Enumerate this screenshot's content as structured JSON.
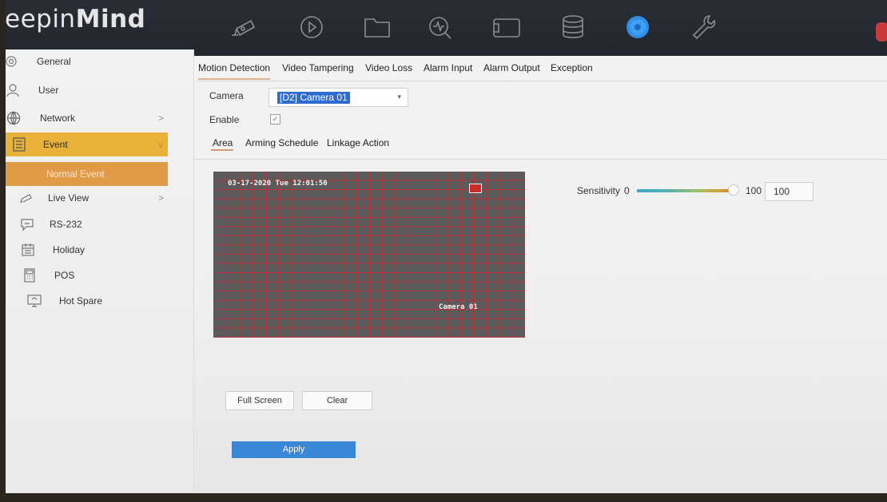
{
  "app": {
    "logo_light": "eepin",
    "logo_bold": "Mind"
  },
  "top_icons": [
    "camera-icon",
    "playback-icon",
    "folder-icon",
    "search-icon",
    "video-icon",
    "storage-icon",
    "settings-icon",
    "wrench-icon"
  ],
  "sidebar": {
    "items": [
      {
        "label": "General",
        "icon": "gear-icon"
      },
      {
        "label": "User",
        "icon": "user-icon"
      },
      {
        "label": "Network",
        "icon": "globe-icon",
        "chevron": ">"
      },
      {
        "label": "Event",
        "icon": "event-icon",
        "chevron": "v"
      },
      {
        "label": "Normal Event"
      },
      {
        "label": "Live View",
        "icon": "camera-icon",
        "chevron": ">"
      },
      {
        "label": "RS-232",
        "icon": "chat-icon"
      },
      {
        "label": "Holiday",
        "icon": "calendar-icon"
      },
      {
        "label": "POS",
        "icon": "pos-icon"
      },
      {
        "label": "Hot Spare",
        "icon": "monitor-icon"
      }
    ]
  },
  "main_tabs": [
    "Motion Detection",
    "Video Tampering",
    "Video Loss",
    "Alarm Input",
    "Alarm Output",
    "Exception"
  ],
  "form": {
    "camera_label": "Camera",
    "camera_value": "[D2] Camera 01",
    "enable_label": "Enable",
    "enable_check": "✓"
  },
  "sub_tabs": [
    "Area",
    "Arming Schedule",
    "Linkage Action"
  ],
  "video": {
    "timestamp": "03-17-2020 Tue 12:01:50",
    "camera_name": "Camera 01"
  },
  "sensitivity": {
    "label": "Sensitivity",
    "min": "0",
    "max": "100",
    "value": "100",
    "fraction": 1.0
  },
  "buttons": {
    "full_screen": "Full Screen",
    "clear": "Clear",
    "apply": "Apply"
  },
  "colors": {
    "event_active": "#e8b23a",
    "sub_active": "#e19a45",
    "apply": "#3a87d8",
    "grid": "#c82832"
  }
}
